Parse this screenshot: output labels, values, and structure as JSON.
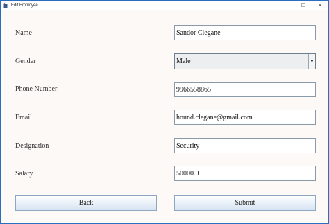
{
  "window": {
    "title": "Edit Employee"
  },
  "controls": {
    "minimize": "—",
    "maximize": "☐",
    "close": "✕"
  },
  "form": {
    "name_label": "Name",
    "name_value": "Sandor Clegane",
    "gender_label": "Gender",
    "gender_value": "Male",
    "phone_label": "Phone Number",
    "phone_value": "9966558865",
    "email_label": "Email",
    "email_value": "hound.clegane@gmail.com",
    "designation_label": "Designation",
    "designation_value": "Security",
    "salary_label": "Salary",
    "salary_value": "50000.0"
  },
  "buttons": {
    "back": "Back",
    "submit": "Submit"
  },
  "icons": {
    "app": "java-coffee-icon",
    "dropdown": "dropdown-arrow-icon"
  },
  "colors": {
    "window_border": "#2a6fbf",
    "background": "#fdf9f6",
    "button_gradient_bottom": "#d6e3f2"
  }
}
